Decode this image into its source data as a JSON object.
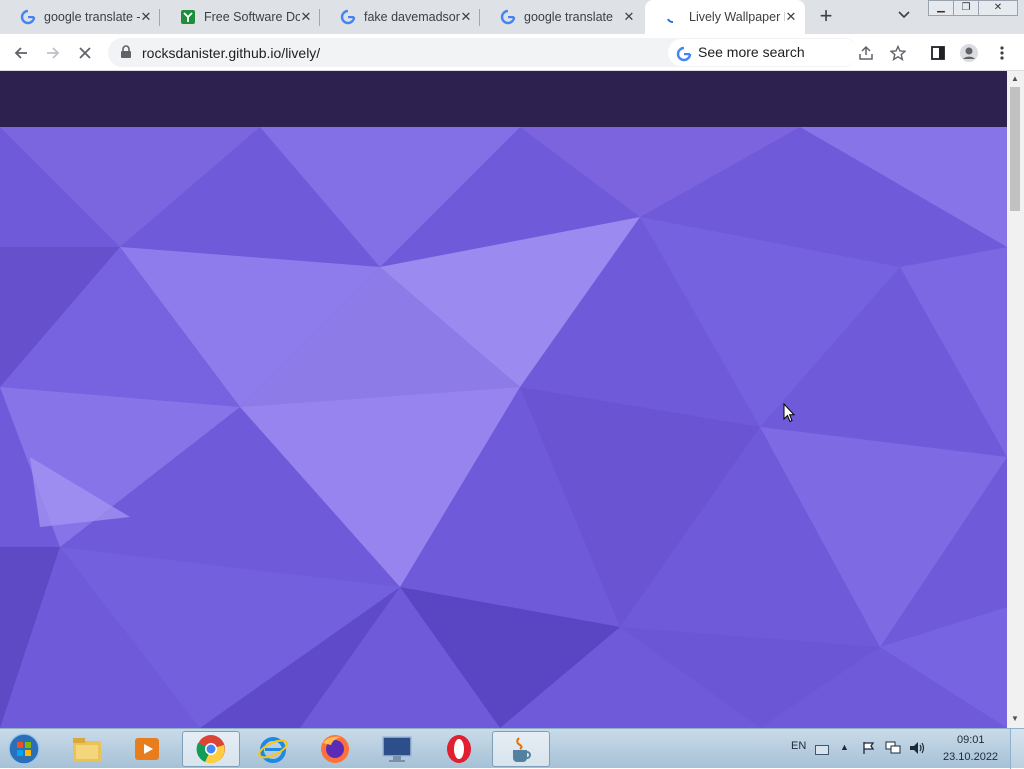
{
  "browser": {
    "tabs": [
      {
        "title": "google translate -",
        "icon": "google-g-icon"
      },
      {
        "title": "Free Software Do",
        "icon": "software-site-icon"
      },
      {
        "title": "fake davemadson",
        "icon": "google-g-icon"
      },
      {
        "title": "google translate",
        "icon": "google-g-icon"
      },
      {
        "title": "Lively Wallpaper L",
        "icon": "loading-spinner-icon",
        "active": true
      }
    ],
    "new_tab_label": "+",
    "url": "rocksdanister.github.io/lively/",
    "search_chip": "See more search results"
  },
  "page": {
    "navbar_color": "#2d2150",
    "hero_color": "#6f5ad9"
  },
  "taskbar": {
    "apps": [
      "start-orb",
      "file-explorer",
      "media-player",
      "chrome",
      "internet-explorer",
      "firefox",
      "remote-desktop",
      "opera",
      "java"
    ],
    "language": "EN",
    "time": "09:01",
    "date": "23.10.2022"
  }
}
